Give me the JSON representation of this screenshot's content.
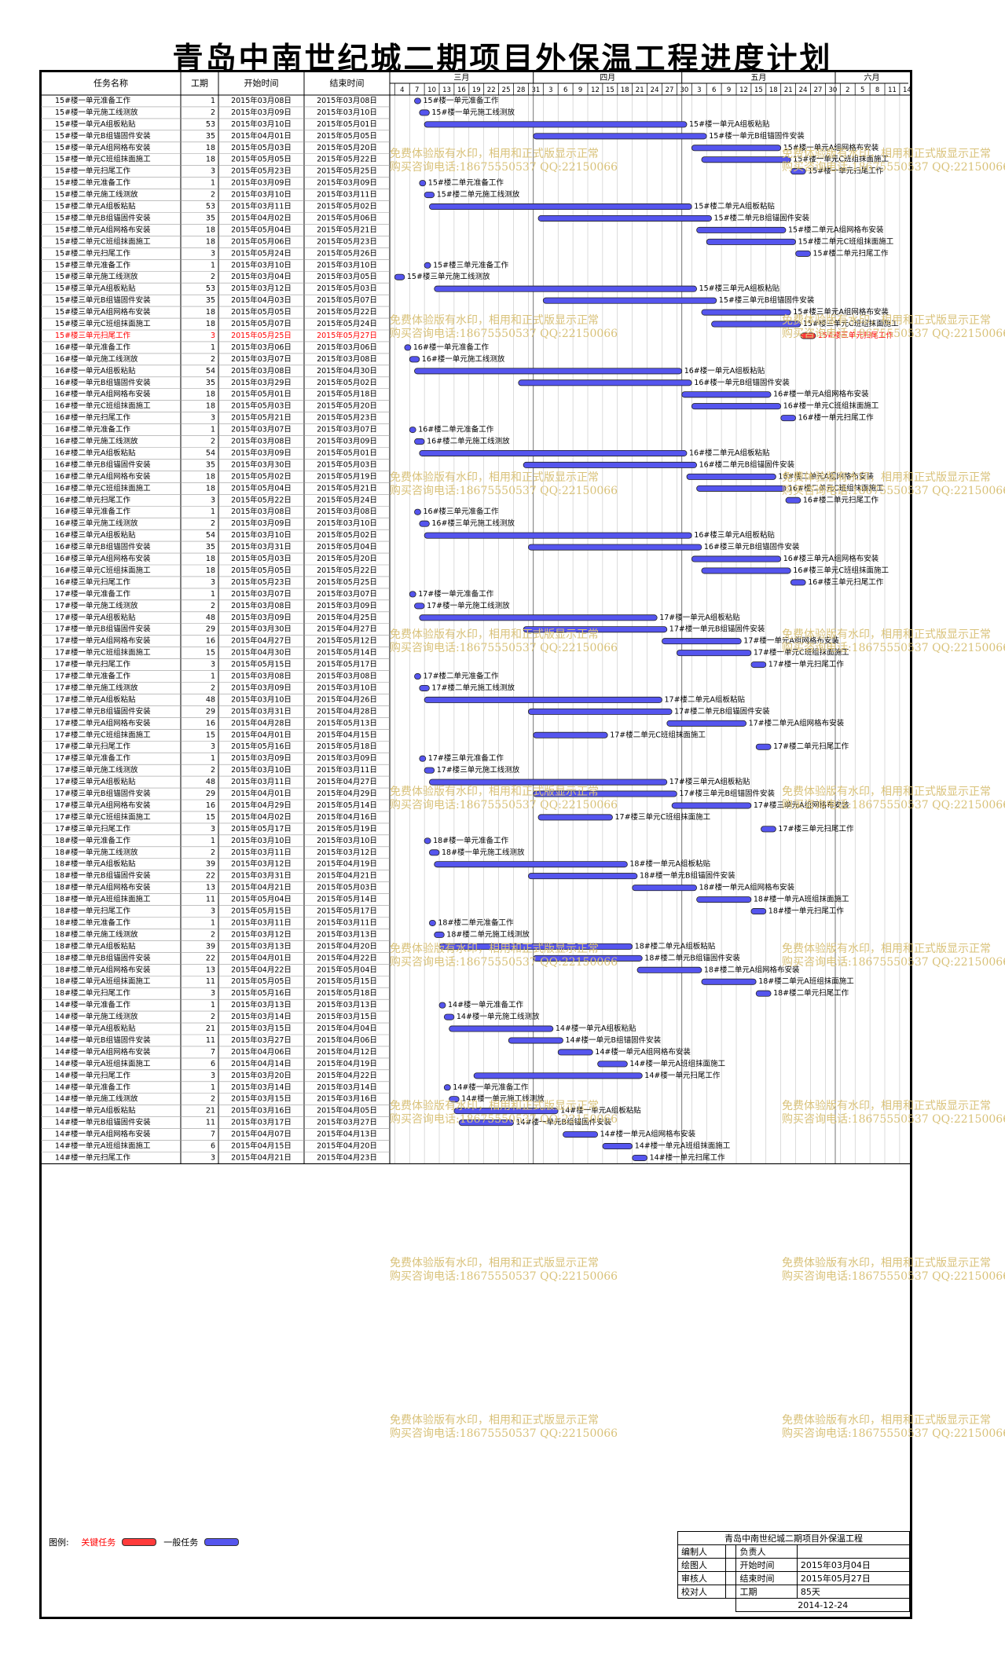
{
  "title": "青岛中南世纪城二期项目外保温工程进度计划",
  "columns": {
    "name": "任务名称",
    "duration": "工期",
    "start": "开始时间",
    "end": "结束时间"
  },
  "months": [
    {
      "label": "三月",
      "start": "2015-03-01",
      "end": "2015-03-31"
    },
    {
      "label": "四月",
      "start": "2015-04-01",
      "end": "2015-04-30"
    },
    {
      "label": "五月",
      "start": "2015-05-01",
      "end": "2015-05-31"
    },
    {
      "label": "六月",
      "start": "2015-06-01",
      "end": "2015-06-15"
    }
  ],
  "day_ticks": [
    "4",
    "7",
    "10",
    "13",
    "16",
    "19",
    "22",
    "25",
    "28",
    "31",
    "3",
    "6",
    "9",
    "12",
    "15",
    "18",
    "21",
    "24",
    "27",
    "30",
    "3",
    "6",
    "9",
    "12",
    "15",
    "18",
    "21",
    "24",
    "27",
    "30",
    "2",
    "5",
    "8",
    "11",
    "14"
  ],
  "legend": {
    "label": "图例:",
    "critical": "关键任务",
    "normal": "一般任务"
  },
  "colors": {
    "normal_bar": "#5555ee",
    "critical_bar": "#ff3b3b",
    "critical_text": "#ff0000",
    "grid": "#b8b8b8",
    "watermark": "#d9c27a"
  },
  "watermark": {
    "line1": "免费体验版有水印，相用和正式版显示正常",
    "line2": "购买咨询电话:18675550537 QQ:22150066"
  },
  "signoff": {
    "project": "青岛中南世纪城二期项目外保温工程",
    "rows": [
      [
        "编制人",
        "",
        "负责人",
        ""
      ],
      [
        "绘图人",
        "",
        "开始时间",
        "2015年03月04日"
      ],
      [
        "审核人",
        "",
        "结束时间",
        "2015年05月27日"
      ],
      [
        "校对人",
        "",
        "工期",
        "85天"
      ]
    ],
    "date": "2014-12-24"
  },
  "chart_data": {
    "type": "gantt",
    "title": "青岛中南世纪城二期项目外保温工程进度计划",
    "x_range": [
      "2015-03-03",
      "2015-06-15"
    ],
    "tasks": [
      {
        "name": "15#楼一单元准备工作",
        "duration": 1,
        "start": "2015年03月08日",
        "end": "2015年03月08日",
        "critical": false
      },
      {
        "name": "15#楼一单元施工线测放",
        "duration": 2,
        "start": "2015年03月09日",
        "end": "2015年03月10日",
        "critical": false
      },
      {
        "name": "15#楼一单元A组板粘贴",
        "duration": 53,
        "start": "2015年03月10日",
        "end": "2015年05月01日",
        "critical": false
      },
      {
        "name": "15#楼一单元B组锚固件安装",
        "duration": 35,
        "start": "2015年04月01日",
        "end": "2015年05月05日",
        "critical": false
      },
      {
        "name": "15#楼一单元A组网格布安装",
        "duration": 18,
        "start": "2015年05月03日",
        "end": "2015年05月20日",
        "critical": false
      },
      {
        "name": "15#楼一单元C班组抹面施工",
        "duration": 18,
        "start": "2015年05月05日",
        "end": "2015年05月22日",
        "critical": false
      },
      {
        "name": "15#楼一单元扫尾工作",
        "duration": 3,
        "start": "2015年05月23日",
        "end": "2015年05月25日",
        "critical": false
      },
      {
        "name": "15#楼二单元准备工作",
        "duration": 1,
        "start": "2015年03月09日",
        "end": "2015年03月09日",
        "critical": false
      },
      {
        "name": "15#楼二单元施工线测放",
        "duration": 2,
        "start": "2015年03月10日",
        "end": "2015年03月11日",
        "critical": false
      },
      {
        "name": "15#楼二单元A组板粘贴",
        "duration": 53,
        "start": "2015年03月11日",
        "end": "2015年05月02日",
        "critical": false
      },
      {
        "name": "15#楼二单元B组锚固件安装",
        "duration": 35,
        "start": "2015年04月02日",
        "end": "2015年05月06日",
        "critical": false
      },
      {
        "name": "15#楼二单元A组网格布安装",
        "duration": 18,
        "start": "2015年05月04日",
        "end": "2015年05月21日",
        "critical": false
      },
      {
        "name": "15#楼二单元C班组抹面施工",
        "duration": 18,
        "start": "2015年05月06日",
        "end": "2015年05月23日",
        "critical": false
      },
      {
        "name": "15#楼二单元扫尾工作",
        "duration": 3,
        "start": "2015年05月24日",
        "end": "2015年05月26日",
        "critical": false
      },
      {
        "name": "15#楼三单元准备工作",
        "duration": 1,
        "start": "2015年03月10日",
        "end": "2015年03月10日",
        "critical": false
      },
      {
        "name": "15#楼三单元施工线测放",
        "duration": 2,
        "start": "2015年03月04日",
        "end": "2015年03月05日",
        "critical": false
      },
      {
        "name": "15#楼三单元A组板粘贴",
        "duration": 53,
        "start": "2015年03月12日",
        "end": "2015年05月03日",
        "critical": false
      },
      {
        "name": "15#楼三单元B组锚固件安装",
        "duration": 35,
        "start": "2015年04月03日",
        "end": "2015年05月07日",
        "critical": false
      },
      {
        "name": "15#楼三单元A组网格布安装",
        "duration": 18,
        "start": "2015年05月05日",
        "end": "2015年05月22日",
        "critical": false
      },
      {
        "name": "15#楼三单元C班组抹面施工",
        "duration": 18,
        "start": "2015年05月07日",
        "end": "2015年05月24日",
        "critical": false
      },
      {
        "name": "15#楼三单元扫尾工作",
        "duration": 3,
        "start": "2015年05月25日",
        "end": "2015年05月27日",
        "critical": true
      },
      {
        "name": "16#楼一单元准备工作",
        "duration": 1,
        "start": "2015年03月06日",
        "end": "2015年03月06日",
        "critical": false
      },
      {
        "name": "16#楼一单元施工线测放",
        "duration": 2,
        "start": "2015年03月07日",
        "end": "2015年03月08日",
        "critical": false
      },
      {
        "name": "16#楼一单元A组板粘贴",
        "duration": 54,
        "start": "2015年03月08日",
        "end": "2015年04月30日",
        "critical": false
      },
      {
        "name": "16#楼一单元B组锚固件安装",
        "duration": 35,
        "start": "2015年03月29日",
        "end": "2015年05月02日",
        "critical": false
      },
      {
        "name": "16#楼一单元A组网格布安装",
        "duration": 18,
        "start": "2015年05月01日",
        "end": "2015年05月18日",
        "critical": false
      },
      {
        "name": "16#楼一单元C班组抹面施工",
        "duration": 18,
        "start": "2015年05月03日",
        "end": "2015年05月20日",
        "critical": false
      },
      {
        "name": "16#楼一单元扫尾工作",
        "duration": 3,
        "start": "2015年05月21日",
        "end": "2015年05月23日",
        "critical": false
      },
      {
        "name": "16#楼二单元准备工作",
        "duration": 1,
        "start": "2015年03月07日",
        "end": "2015年03月07日",
        "critical": false
      },
      {
        "name": "16#楼二单元施工线测放",
        "duration": 2,
        "start": "2015年03月08日",
        "end": "2015年03月09日",
        "critical": false
      },
      {
        "name": "16#楼二单元A组板粘贴",
        "duration": 54,
        "start": "2015年03月09日",
        "end": "2015年05月01日",
        "critical": false
      },
      {
        "name": "16#楼二单元B组锚固件安装",
        "duration": 35,
        "start": "2015年03月30日",
        "end": "2015年05月03日",
        "critical": false
      },
      {
        "name": "16#楼二单元A组网格布安装",
        "duration": 18,
        "start": "2015年05月02日",
        "end": "2015年05月19日",
        "critical": false
      },
      {
        "name": "16#楼二单元C班组抹面施工",
        "duration": 18,
        "start": "2015年05月04日",
        "end": "2015年05月21日",
        "critical": false
      },
      {
        "name": "16#楼二单元扫尾工作",
        "duration": 3,
        "start": "2015年05月22日",
        "end": "2015年05月24日",
        "critical": false
      },
      {
        "name": "16#楼三单元准备工作",
        "duration": 1,
        "start": "2015年03月08日",
        "end": "2015年03月08日",
        "critical": false
      },
      {
        "name": "16#楼三单元施工线测放",
        "duration": 2,
        "start": "2015年03月09日",
        "end": "2015年03月10日",
        "critical": false
      },
      {
        "name": "16#楼三单元A组板粘贴",
        "duration": 54,
        "start": "2015年03月10日",
        "end": "2015年05月02日",
        "critical": false
      },
      {
        "name": "16#楼三单元B组锚固件安装",
        "duration": 35,
        "start": "2015年03月31日",
        "end": "2015年05月04日",
        "critical": false
      },
      {
        "name": "16#楼三单元A组网格布安装",
        "duration": 18,
        "start": "2015年05月03日",
        "end": "2015年05月20日",
        "critical": false
      },
      {
        "name": "16#楼三单元C班组抹面施工",
        "duration": 18,
        "start": "2015年05月05日",
        "end": "2015年05月22日",
        "critical": false
      },
      {
        "name": "16#楼三单元扫尾工作",
        "duration": 3,
        "start": "2015年05月23日",
        "end": "2015年05月25日",
        "critical": false
      },
      {
        "name": "17#楼一单元准备工作",
        "duration": 1,
        "start": "2015年03月07日",
        "end": "2015年03月07日",
        "critical": false
      },
      {
        "name": "17#楼一单元施工线测放",
        "duration": 2,
        "start": "2015年03月08日",
        "end": "2015年03月09日",
        "critical": false
      },
      {
        "name": "17#楼一单元A组板粘贴",
        "duration": 48,
        "start": "2015年03月09日",
        "end": "2015年04月25日",
        "critical": false
      },
      {
        "name": "17#楼一单元B组锚固件安装",
        "duration": 29,
        "start": "2015年03月30日",
        "end": "2015年04月27日",
        "critical": false
      },
      {
        "name": "17#楼一单元A组网格布安装",
        "duration": 16,
        "start": "2015年04月27日",
        "end": "2015年05月12日",
        "critical": false
      },
      {
        "name": "17#楼一单元C班组抹面施工",
        "duration": 15,
        "start": "2015年04月30日",
        "end": "2015年05月14日",
        "critical": false
      },
      {
        "name": "17#楼一单元扫尾工作",
        "duration": 3,
        "start": "2015年05月15日",
        "end": "2015年05月17日",
        "critical": false
      },
      {
        "name": "17#楼二单元准备工作",
        "duration": 1,
        "start": "2015年03月08日",
        "end": "2015年03月08日",
        "critical": false
      },
      {
        "name": "17#楼二单元施工线测放",
        "duration": 2,
        "start": "2015年03月09日",
        "end": "2015年03月10日",
        "critical": false
      },
      {
        "name": "17#楼二单元A组板粘贴",
        "duration": 48,
        "start": "2015年03月10日",
        "end": "2015年04月26日",
        "critical": false
      },
      {
        "name": "17#楼二单元B组锚固件安装",
        "duration": 29,
        "start": "2015年03月31日",
        "end": "2015年04月28日",
        "critical": false
      },
      {
        "name": "17#楼二单元A组网格布安装",
        "duration": 16,
        "start": "2015年04月28日",
        "end": "2015年05月13日",
        "critical": false
      },
      {
        "name": "17#楼二单元C班组抹面施工",
        "duration": 15,
        "start": "2015年04月01日",
        "end": "2015年04月15日",
        "critical": false
      },
      {
        "name": "17#楼二单元扫尾工作",
        "duration": 3,
        "start": "2015年05月16日",
        "end": "2015年05月18日",
        "critical": false
      },
      {
        "name": "17#楼三单元准备工作",
        "duration": 1,
        "start": "2015年03月09日",
        "end": "2015年03月09日",
        "critical": false
      },
      {
        "name": "17#楼三单元施工线测放",
        "duration": 2,
        "start": "2015年03月10日",
        "end": "2015年03月11日",
        "critical": false
      },
      {
        "name": "17#楼三单元A组板粘贴",
        "duration": 48,
        "start": "2015年03月11日",
        "end": "2015年04月27日",
        "critical": false
      },
      {
        "name": "17#楼三单元B组锚固件安装",
        "duration": 29,
        "start": "2015年04月01日",
        "end": "2015年04月29日",
        "critical": false
      },
      {
        "name": "17#楼三单元A组网格布安装",
        "duration": 16,
        "start": "2015年04月29日",
        "end": "2015年05月14日",
        "critical": false
      },
      {
        "name": "17#楼三单元C班组抹面施工",
        "duration": 15,
        "start": "2015年04月02日",
        "end": "2015年04月16日",
        "critical": false
      },
      {
        "name": "17#楼三单元扫尾工作",
        "duration": 3,
        "start": "2015年05月17日",
        "end": "2015年05月19日",
        "critical": false
      },
      {
        "name": "18#楼一单元准备工作",
        "duration": 1,
        "start": "2015年03月10日",
        "end": "2015年03月10日",
        "critical": false
      },
      {
        "name": "18#楼一单元施工线测放",
        "duration": 2,
        "start": "2015年03月11日",
        "end": "2015年03月12日",
        "critical": false
      },
      {
        "name": "18#楼一单元A组板粘贴",
        "duration": 39,
        "start": "2015年03月12日",
        "end": "2015年04月19日",
        "critical": false
      },
      {
        "name": "18#楼一单元B组锚固件安装",
        "duration": 22,
        "start": "2015年03月31日",
        "end": "2015年04月21日",
        "critical": false
      },
      {
        "name": "18#楼一单元A组网格布安装",
        "duration": 13,
        "start": "2015年04月21日",
        "end": "2015年05月03日",
        "critical": false
      },
      {
        "name": "18#楼一单元A班组抹面施工",
        "duration": 11,
        "start": "2015年05月04日",
        "end": "2015年05月14日",
        "critical": false
      },
      {
        "name": "18#楼一单元扫尾工作",
        "duration": 3,
        "start": "2015年05月15日",
        "end": "2015年05月17日",
        "critical": false
      },
      {
        "name": "18#楼二单元准备工作",
        "duration": 1,
        "start": "2015年03月11日",
        "end": "2015年03月11日",
        "critical": false
      },
      {
        "name": "18#楼二单元施工线测放",
        "duration": 2,
        "start": "2015年03月12日",
        "end": "2015年03月13日",
        "critical": false
      },
      {
        "name": "18#楼二单元A组板粘贴",
        "duration": 39,
        "start": "2015年03月13日",
        "end": "2015年04月20日",
        "critical": false
      },
      {
        "name": "18#楼二单元B组锚固件安装",
        "duration": 22,
        "start": "2015年04月01日",
        "end": "2015年04月22日",
        "critical": false
      },
      {
        "name": "18#楼二单元A组网格布安装",
        "duration": 13,
        "start": "2015年04月22日",
        "end": "2015年05月04日",
        "critical": false
      },
      {
        "name": "18#楼二单元A班组抹面施工",
        "duration": 11,
        "start": "2015年05月05日",
        "end": "2015年05月15日",
        "critical": false
      },
      {
        "name": "18#楼二单元扫尾工作",
        "duration": 3,
        "start": "2015年05月16日",
        "end": "2015年05月18日",
        "critical": false
      },
      {
        "name": "14#楼一单元准备工作",
        "duration": 1,
        "start": "2015年03月13日",
        "end": "2015年03月13日",
        "critical": false
      },
      {
        "name": "14#楼一单元施工线测放",
        "duration": 2,
        "start": "2015年03月14日",
        "end": "2015年03月15日",
        "critical": false
      },
      {
        "name": "14#楼一单元A组板粘贴",
        "duration": 21,
        "start": "2015年03月15日",
        "end": "2015年04月04日",
        "critical": false
      },
      {
        "name": "14#楼一单元B组锚固件安装",
        "duration": 11,
        "start": "2015年03月27日",
        "end": "2015年04月06日",
        "critical": false
      },
      {
        "name": "14#楼一单元A组网格布安装",
        "duration": 7,
        "start": "2015年04月06日",
        "end": "2015年04月12日",
        "critical": false
      },
      {
        "name": "14#楼一单元A班组抹面施工",
        "duration": 6,
        "start": "2015年04月14日",
        "end": "2015年04月19日",
        "critical": false
      },
      {
        "name": "14#楼一单元扫尾工作",
        "duration": 3,
        "start": "2015年03月20日",
        "end": "2015年04月22日",
        "critical": false
      },
      {
        "name": "14#楼一单元准备工作",
        "duration": 1,
        "start": "2015年03月14日",
        "end": "2015年03月14日",
        "critical": false
      },
      {
        "name": "14#楼一单元施工线测放",
        "duration": 2,
        "start": "2015年03月15日",
        "end": "2015年03月16日",
        "critical": false
      },
      {
        "name": "14#楼一单元A组板粘贴",
        "duration": 21,
        "start": "2015年03月16日",
        "end": "2015年04月05日",
        "critical": false
      },
      {
        "name": "14#楼一单元B组锚固件安装",
        "duration": 11,
        "start": "2015年03月17日",
        "end": "2015年03月27日",
        "critical": false
      },
      {
        "name": "14#楼一单元A组网格布安装",
        "duration": 7,
        "start": "2015年04月07日",
        "end": "2015年04月13日",
        "critical": false
      },
      {
        "name": "14#楼一单元A班组抹面施工",
        "duration": 6,
        "start": "2015年04月15日",
        "end": "2015年04月20日",
        "critical": false
      },
      {
        "name": "14#楼一单元扫尾工作",
        "duration": 3,
        "start": "2015年04月21日",
        "end": "2015年04月23日",
        "critical": false
      }
    ]
  }
}
